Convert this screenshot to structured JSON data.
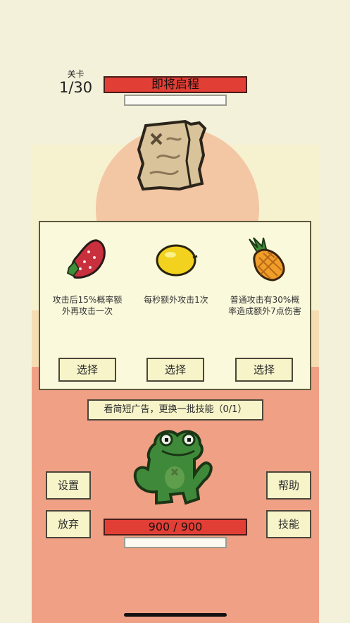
{
  "stage": {
    "label": "关卡",
    "value": "1/30"
  },
  "enemy": {
    "name": "即将启程",
    "icon": "treasure-map-icon"
  },
  "skills": [
    {
      "icon": "strawberry-icon",
      "description": "攻击后15%概率额外再攻击一次",
      "button": "选择"
    },
    {
      "icon": "lemon-icon",
      "description": "每秒额外攻击1次",
      "button": "选择"
    },
    {
      "icon": "pineapple-icon",
      "description": "普通攻击有30%概率造成额外7点伤害",
      "button": "选择"
    }
  ],
  "ad_refresh": "看简短广告，更换一批技能（0/1）",
  "player": {
    "hp_text": "900 / 900",
    "icon": "frog-icon"
  },
  "buttons": {
    "settings": "设置",
    "giveup": "放弃",
    "help": "帮助",
    "skills": "技能"
  },
  "colors": {
    "red_bar": "#e13f36",
    "panel": "#fbf9dc",
    "button": "#f6f4c8",
    "ground": "#f0a085"
  }
}
